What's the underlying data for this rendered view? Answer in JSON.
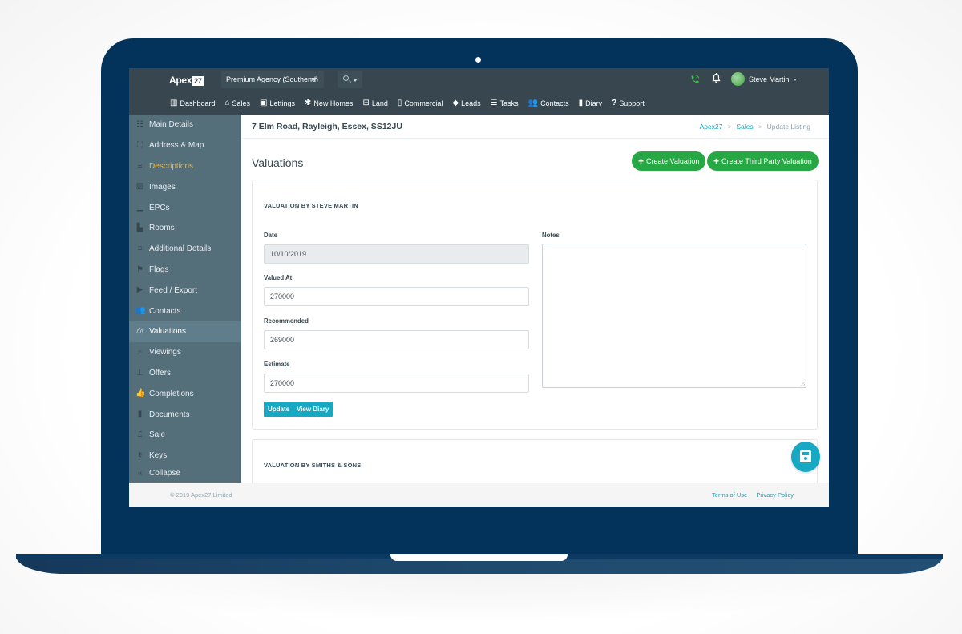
{
  "app": {
    "brand": "Apex",
    "brand_badge": "27",
    "agency_selector": "Premium Agency (Southend)",
    "user": {
      "name": "Steve Martin"
    },
    "icons": {
      "phone": "phone-icon",
      "notifications": "bell-icon",
      "search": "search-icon"
    }
  },
  "nav": [
    {
      "label": "Dashboard",
      "icon": "▥"
    },
    {
      "label": "Sales",
      "icon": "⌂"
    },
    {
      "label": "Lettings",
      "icon": "▣"
    },
    {
      "label": "New Homes",
      "icon": "✱"
    },
    {
      "label": "Land",
      "icon": "⊞"
    },
    {
      "label": "Commercial",
      "icon": "▯"
    },
    {
      "label": "Leads",
      "icon": "◆"
    },
    {
      "label": "Tasks",
      "icon": "☰"
    },
    {
      "label": "Contacts",
      "icon": "👥"
    },
    {
      "label": "Diary",
      "icon": "▮"
    },
    {
      "label": "Support",
      "icon": "?"
    }
  ],
  "sidebar": {
    "items": [
      {
        "label": "Main Details",
        "icon": "☷"
      },
      {
        "label": "Address & Map",
        "icon": "⛶"
      },
      {
        "label": "Descriptions",
        "icon": "≡"
      },
      {
        "label": "Images",
        "icon": "▨"
      },
      {
        "label": "EPCs",
        "icon": "▁"
      },
      {
        "label": "Rooms",
        "icon": "▙"
      },
      {
        "label": "Additional Details",
        "icon": "≡"
      },
      {
        "label": "Flags",
        "icon": "⚑"
      },
      {
        "label": "Feed / Export",
        "icon": "▶"
      },
      {
        "label": "Contacts",
        "icon": "👥"
      },
      {
        "label": "Valuations",
        "icon": "⚖"
      },
      {
        "label": "Viewings",
        "icon": "⌕"
      },
      {
        "label": "Offers",
        "icon": "⊥"
      },
      {
        "label": "Completions",
        "icon": "👍"
      },
      {
        "label": "Documents",
        "icon": "▮"
      },
      {
        "label": "Sale",
        "icon": "£"
      },
      {
        "label": "Keys",
        "icon": "⚷"
      },
      {
        "label": "Collapse",
        "icon": "«"
      }
    ],
    "highlighted": "Descriptions",
    "selected": "Valuations"
  },
  "page": {
    "title": "7 Elm Road, Rayleigh, Essex, SS12JU",
    "breadcrumb": [
      "Apex27",
      "Sales",
      "Update Listing"
    ],
    "section_title": "Valuations",
    "buttons": {
      "create_valuation": "Create Valuation",
      "create_third_party": "Create Third Party Valuation"
    }
  },
  "valuations": [
    {
      "title": "VALUATION BY STEVE MARTIN",
      "date_label": "Date",
      "date": "10/10/2019",
      "valued_at_label": "Valued At",
      "valued_at": "270000",
      "recommended_label": "Recommended",
      "recommended": "269000",
      "estimate_label": "Estimate",
      "estimate": "270000",
      "notes_label": "Notes",
      "notes": "",
      "update_label": "Update",
      "view_diary_label": "View Diary"
    },
    {
      "title": "VALUATION BY SMITHS & SONS"
    }
  ],
  "footer": {
    "copyright": "© 2019 Apex27 Limited",
    "links": [
      "Terms of Use",
      "Privacy Policy"
    ]
  },
  "colors": {
    "topbar": "#38474f",
    "sidebar": "#546e7a",
    "accent_green": "#28a745",
    "accent_teal": "#17a9c4",
    "highlight_text": "#f4b942",
    "laptop_body": "#03325a"
  }
}
